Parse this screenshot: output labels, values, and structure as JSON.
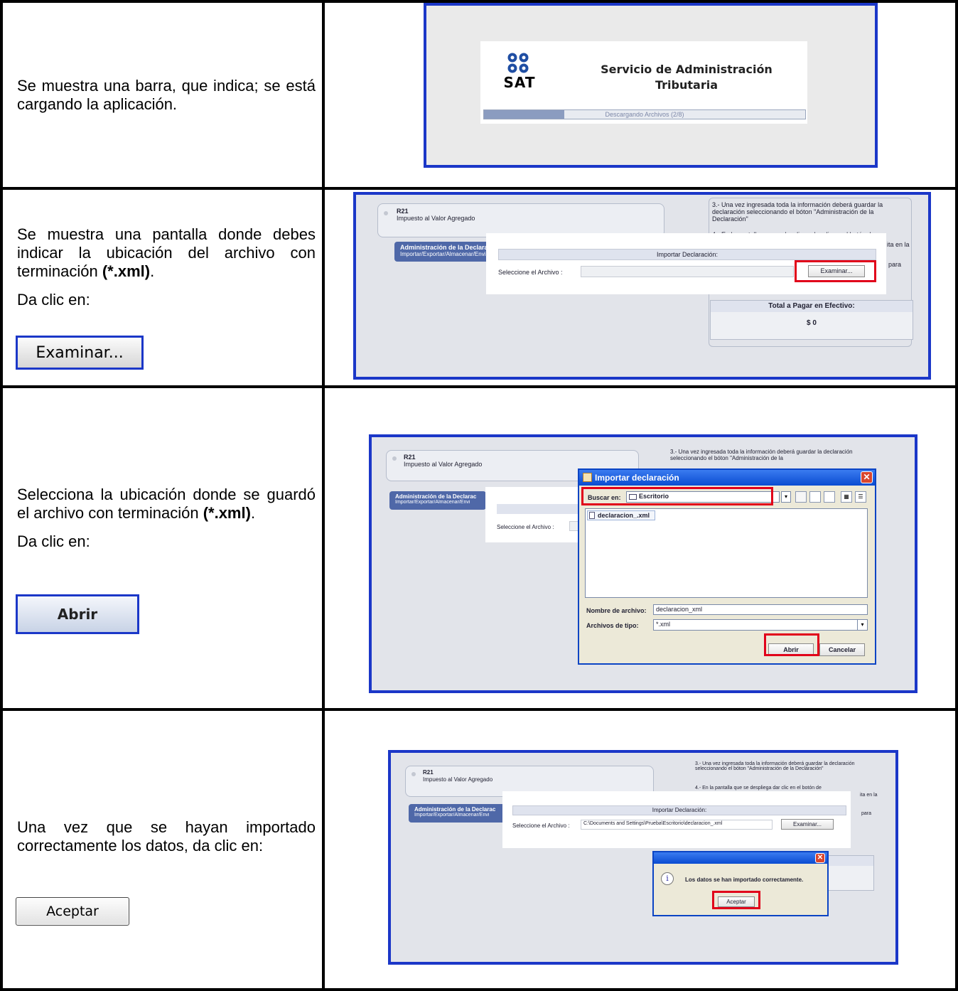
{
  "rows": [
    {
      "text": [
        "Se muestra una barra, que indica; se está cargando la aplicación."
      ],
      "shot": {
        "org_name_line1": "Servicio de Administración",
        "org_name_line2": "Tributaria",
        "logo_text": "SAT",
        "progress_text": "Descargando Archivos (2/8)",
        "progress": 0.25
      }
    },
    {
      "text_line1": "Se muestra una pantalla donde debes indicar la ubicación del archivo con terminación ",
      "text_bold": "(*.xml)",
      "text_end": ".",
      "click_label": "Da clic en:",
      "button": "Examinar...",
      "shot": {
        "r21_code": "R21",
        "r21_desc": "Impuesto al Valor Agregado",
        "admin_title": "Administración de la Declarac",
        "admin_sub": "Importar/Exportar/Almacenar/Envi",
        "instr_3": "3.- Una vez ingresada toda la información deberá guardar la declaración seleccionando el bóton \"Administración de la Declaración\"",
        "instr_4": "4.- En la pantalla que se despliega dar clic en el botón de",
        "instr_tail1": "ita en la",
        "instr_tail2": "para",
        "import_header": "Importar Declaración:",
        "file_label": "Seleccione el Archivo :",
        "examinar": "Examinar...",
        "total_label": "Total a Pagar en Efectivo:",
        "total_value": "$ 0"
      }
    },
    {
      "text_line1": "Selecciona la ubicación donde se guardó el archivo  con terminación ",
      "text_bold": "(*.xml)",
      "text_end": ".",
      "click_label": "Da clic en:",
      "button": "Abrir",
      "shot": {
        "r21_code": "R21",
        "r21_desc": "Impuesto al Valor Agregado",
        "admin_title": "Administración de la Declarac",
        "admin_sub": "Importar/Exportar/Almacenar/Envi",
        "instr_3": "3.- Una vez ingresada toda la información deberá guardar la declaración seleccionando el bóton \"Administración de la",
        "file_label": "Seleccione el Archivo :",
        "dialog_title": "Importar declaración",
        "buscar_label": "Buscar en:",
        "buscar_value": "Escritorio",
        "file_item": "declaracion_.xml",
        "nombre_label": "Nombre de archivo:",
        "nombre_value": "declaracion_xml",
        "tipo_label": "Archivos de tipo:",
        "tipo_value": "*.xml",
        "abrir": "Abrir",
        "cancelar": "Cancelar"
      }
    },
    {
      "text_line1": "Una vez que se hayan importado correctamente los datos, da clic en:",
      "button": "Aceptar",
      "shot": {
        "r21_code": "R21",
        "r21_desc": "Impuesto al Valor Agregado",
        "admin_title": "Administración de la Declarac",
        "admin_sub": "Importar/Exportar/Almacenar/Envi",
        "instr_3": "3.- Una vez ingresada toda la información deberá guardar la declaración seleccionando el bóton \"Administración de la Declaración\"",
        "instr_4": "4.- En la pantalla que se despliega dar clic en el botón de",
        "instr_tail1": "ita en la",
        "instr_tail2": "para",
        "import_header": "Importar Declaración:",
        "file_label": "Seleccione el Archivo :",
        "file_path": "C:\\Documents and Settings\\Prueba\\Escritorio\\declaracion_.xml",
        "examinar": "Examinar...",
        "msg": "Los datos se han importado correctamente.",
        "aceptar": "Aceptar"
      }
    }
  ]
}
